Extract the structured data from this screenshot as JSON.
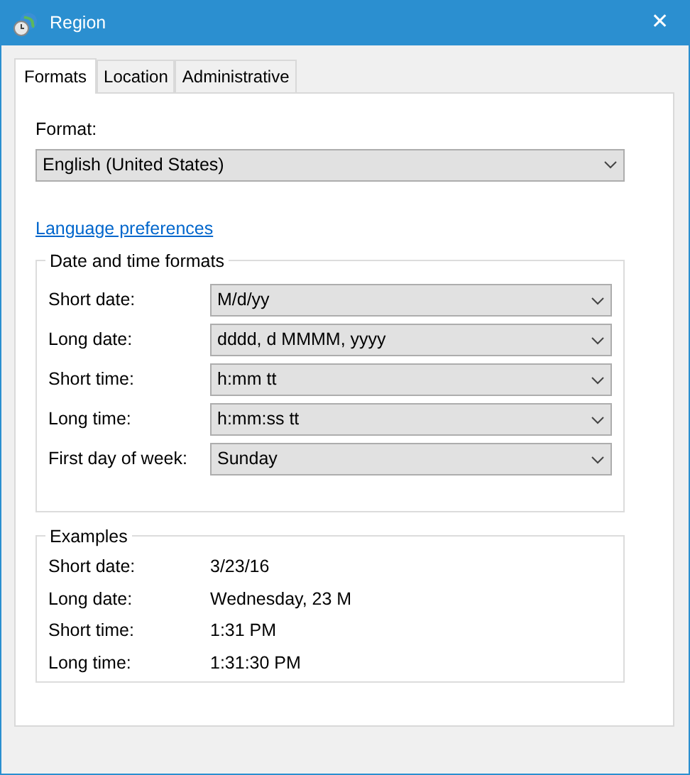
{
  "window": {
    "title": "Region",
    "close": "✕"
  },
  "tabs": [
    {
      "label": "Formats",
      "selected": true
    },
    {
      "label": "Location",
      "selected": false
    },
    {
      "label": "Administrative",
      "selected": false
    }
  ],
  "format": {
    "label": "Format:",
    "value": "English (United States)"
  },
  "language_link": "Language preferences",
  "date_time_formats": {
    "title": "Date and time formats",
    "rows": [
      {
        "label": "Short date:",
        "value": "M/d/yy"
      },
      {
        "label": "Long date:",
        "value": "dddd, d MMMM, yyyy"
      },
      {
        "label": "Short time:",
        "value": "h:mm tt"
      },
      {
        "label": "Long time:",
        "value": "h:mm:ss tt"
      },
      {
        "label": "First day of week:",
        "value": "Sunday"
      }
    ]
  },
  "examples": {
    "title": "Examples",
    "rows": [
      {
        "label": "Short date:",
        "value": "3/23/16"
      },
      {
        "label": "Long date:",
        "value": "Wednesday, 23 M"
      },
      {
        "label": "Short time:",
        "value": "1:31 PM"
      },
      {
        "label": "Long time:",
        "value": "1:31:30 PM"
      }
    ]
  }
}
